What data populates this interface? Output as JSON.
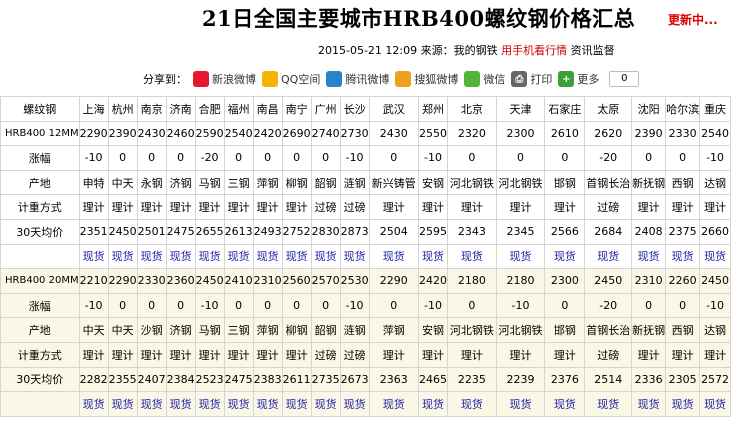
{
  "header": {
    "title": "21日全国主要城市HRB400螺纹钢价格汇总",
    "updating": "更新中...",
    "date": "2015-05-21 12:09",
    "source_label": "来源：",
    "source": "我的钢铁",
    "mobile_link": "用手机看行情",
    "supervise": "资讯监督"
  },
  "share": {
    "label": "分享到：",
    "items": [
      {
        "label": "新浪微博",
        "icon": "weibo-icon",
        "color": "#e6162d"
      },
      {
        "label": "QQ空间",
        "icon": "qzone-icon",
        "color": "#f5b400"
      },
      {
        "label": "腾讯微博",
        "icon": "tencent-weibo-icon",
        "color": "#2a83c6"
      },
      {
        "label": "搜狐微博",
        "icon": "sohu-weibo-icon",
        "color": "#f0a020"
      },
      {
        "label": "微信",
        "icon": "wechat-icon",
        "color": "#51b53b"
      },
      {
        "label": "打印",
        "icon": "print-icon",
        "color": "#666666"
      },
      {
        "label": "更多",
        "icon": "plus-icon",
        "color": "#3aa03a"
      }
    ],
    "count": "0"
  },
  "table": {
    "corner": "螺纹钢",
    "cities": [
      "上海",
      "杭州",
      "南京",
      "济南",
      "合肥",
      "福州",
      "南昌",
      "南宁",
      "广州",
      "长沙",
      "武汉",
      "郑州",
      "北京",
      "天津",
      "石家庄",
      "太原",
      "沈阳",
      "哈尔滨",
      "重庆"
    ],
    "rows": [
      {
        "label": "HRB400 12MM",
        "cells": [
          "2290",
          "2390",
          "2430",
          "2460",
          "2590",
          "2540",
          "2420",
          "2690",
          "2740",
          "2730",
          "2430",
          "2550",
          "2320",
          "2300",
          "2610",
          "2620",
          "2390",
          "2330",
          "2540"
        ]
      },
      {
        "label": "涨幅",
        "cells": [
          "-10",
          "0",
          "0",
          "0",
          "-20",
          "0",
          "0",
          "0",
          "0",
          "-10",
          "0",
          "-10",
          "0",
          "0",
          "0",
          "-20",
          "0",
          "0",
          "-10"
        ]
      },
      {
        "label": "产地",
        "cells": [
          "申特",
          "中天",
          "永钢",
          "济钢",
          "马钢",
          "三钢",
          "萍钢",
          "柳钢",
          "韶钢",
          "涟钢",
          "新兴铸管",
          "安钢",
          "河北钢铁",
          "河北钢铁",
          "邯钢",
          "首钢长治",
          "新抚钢",
          "西钢",
          "达钢"
        ]
      },
      {
        "label": "计重方式",
        "cells": [
          "理计",
          "理计",
          "理计",
          "理计",
          "理计",
          "理计",
          "理计",
          "理计",
          "过磅",
          "过磅",
          "理计",
          "理计",
          "理计",
          "理计",
          "理计",
          "过磅",
          "理计",
          "理计",
          "理计"
        ]
      },
      {
        "label": "30天均价",
        "cells": [
          "2351",
          "2450",
          "2501",
          "2475",
          "2655",
          "2613",
          "2493",
          "2752",
          "2830",
          "2873",
          "2504",
          "2595",
          "2343",
          "2345",
          "2566",
          "2684",
          "2408",
          "2375",
          "2660"
        ]
      },
      {
        "label": "",
        "link": true,
        "cells": [
          "现货",
          "现货",
          "现货",
          "现货",
          "现货",
          "现货",
          "现货",
          "现货",
          "现货",
          "现货",
          "现货",
          "现货",
          "现货",
          "现货",
          "现货",
          "现货",
          "现货",
          "现货",
          "现货"
        ]
      },
      {
        "label": "HRB400 20MM",
        "cells": [
          "2210",
          "2290",
          "2330",
          "2360",
          "2450",
          "2410",
          "2310",
          "2560",
          "2570",
          "2530",
          "2290",
          "2420",
          "2180",
          "2180",
          "2300",
          "2450",
          "2310",
          "2260",
          "2450"
        ]
      },
      {
        "label": "涨幅",
        "cells": [
          "-10",
          "0",
          "0",
          "0",
          "-10",
          "0",
          "0",
          "0",
          "0",
          "-10",
          "0",
          "-10",
          "0",
          "-10",
          "0",
          "-20",
          "0",
          "0",
          "-10"
        ]
      },
      {
        "label": "产地",
        "cells": [
          "中天",
          "中天",
          "沙钢",
          "济钢",
          "马钢",
          "三钢",
          "萍钢",
          "柳钢",
          "韶钢",
          "涟钢",
          "萍钢",
          "安钢",
          "河北钢铁",
          "河北钢铁",
          "邯钢",
          "首钢长治",
          "新抚钢",
          "西钢",
          "达钢"
        ]
      },
      {
        "label": "计重方式",
        "cells": [
          "理计",
          "理计",
          "理计",
          "理计",
          "理计",
          "理计",
          "理计",
          "理计",
          "过磅",
          "过磅",
          "理计",
          "理计",
          "理计",
          "理计",
          "理计",
          "过磅",
          "理计",
          "理计",
          "理计"
        ]
      },
      {
        "label": "30天均价",
        "cells": [
          "2282",
          "2355",
          "2407",
          "2384",
          "2523",
          "2475",
          "2383",
          "2611",
          "2735",
          "2673",
          "2363",
          "2465",
          "2235",
          "2239",
          "2376",
          "2514",
          "2336",
          "2305",
          "2572"
        ]
      },
      {
        "label": "",
        "link": true,
        "cells": [
          "现货",
          "现货",
          "现货",
          "现货",
          "现货",
          "现货",
          "现货",
          "现货",
          "现货",
          "现货",
          "现货",
          "现货",
          "现货",
          "现货",
          "现货",
          "现货",
          "现货",
          "现货",
          "现货"
        ]
      }
    ]
  }
}
